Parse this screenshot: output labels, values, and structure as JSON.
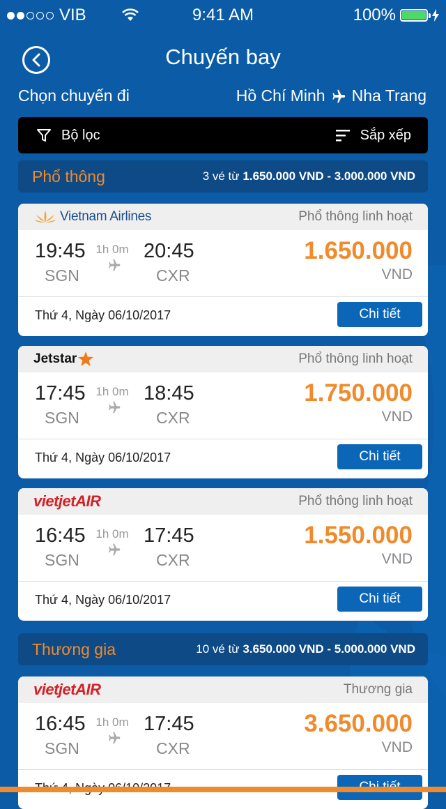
{
  "status_bar": {
    "carrier": "VIB",
    "time": "9:41 AM",
    "battery": "100%",
    "signal_bars_filled": 2,
    "signal_bars_total": 5
  },
  "header": {
    "title": "Chuyến bay"
  },
  "route": {
    "label": "Chọn chuyến đi",
    "from": "Hồ Chí Minh",
    "to": "Nha Trang"
  },
  "toolbar": {
    "filter_label": "Bộ lọc",
    "sort_label": "Sắp xếp"
  },
  "sections": [
    {
      "name": "Phổ thông",
      "summary_prefix": "3 vé từ",
      "summary_range": "1.650.000 VND - 3.000.000 VND"
    },
    {
      "name": "Thương gia",
      "summary_prefix": "10 vé từ",
      "summary_range": "3.650.000 VND - 5.000.000 VND"
    }
  ],
  "flights": [
    {
      "airline": "Vietnam Airlines",
      "logo": "vietnam-airlines-logo",
      "class": "Phổ thông linh hoạt",
      "dep_time": "19:45",
      "dep_code": "SGN",
      "arr_time": "20:45",
      "arr_code": "CXR",
      "duration": "1h 0m",
      "price": "1.650.000",
      "currency": "VND",
      "date": "Thứ 4, Ngày 06/10/2017",
      "detail_label": "Chi tiết"
    },
    {
      "airline": "Jetstar",
      "logo": "jetstar-logo",
      "class": "Phổ thông linh hoạt",
      "dep_time": "17:45",
      "dep_code": "SGN",
      "arr_time": "18:45",
      "arr_code": "CXR",
      "duration": "1h 0m",
      "price": "1.750.000",
      "currency": "VND",
      "date": "Thứ 4, Ngày 06/10/2017",
      "detail_label": "Chi tiết"
    },
    {
      "airline": "vietjetAIR",
      "logo": "vietjet-logo",
      "class": "Phổ thông linh hoạt",
      "dep_time": "16:45",
      "dep_code": "SGN",
      "arr_time": "17:45",
      "arr_code": "CXR",
      "duration": "1h 0m",
      "price": "1.550.000",
      "currency": "VND",
      "date": "Thứ 4, Ngày 06/10/2017",
      "detail_label": "Chi tiết"
    },
    {
      "airline": "vietjetAIR",
      "logo": "vietjet-logo",
      "class": "Thương gia",
      "dep_time": "16:45",
      "dep_code": "SGN",
      "arr_time": "17:45",
      "arr_code": "CXR",
      "duration": "1h 0m",
      "price": "3.650.000",
      "currency": "VND",
      "date": "Thứ 4, Ngày 06/10/2017",
      "detail_label": "Chi tiết"
    }
  ],
  "colors": {
    "background": "#0b5ba6",
    "accent": "#f08a2b",
    "button": "#0b66b8",
    "card_header": "#efefef",
    "section_header": "#0e4a86",
    "battery": "#4cd964"
  }
}
